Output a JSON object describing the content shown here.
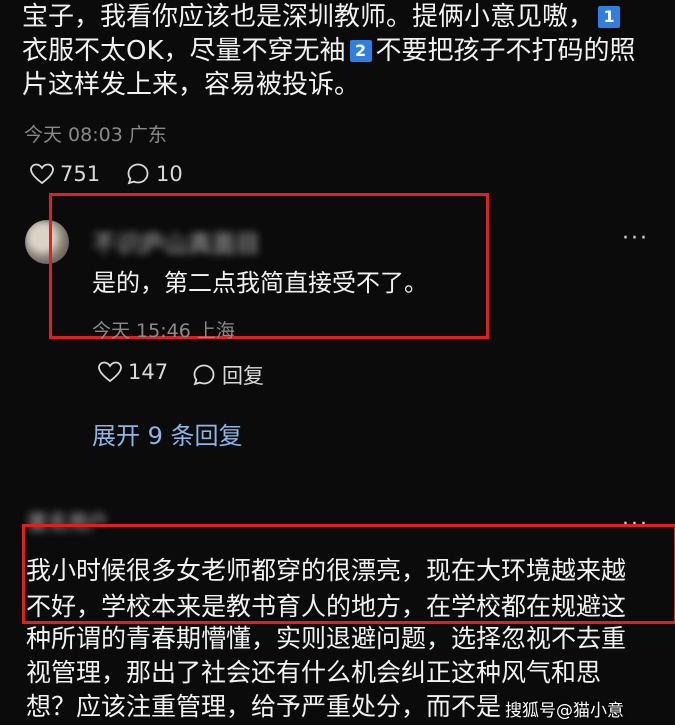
{
  "comment1": {
    "line1": "宝子，我看你应该也是深圳教师。提俩小意见嗷，",
    "badge1": "1",
    "line2a": "衣服不太OK，尽量不穿无袖",
    "badge2": "2",
    "line2b": "不要把孩子不打码的照",
    "line3": "片这样发上来，容易被投诉。",
    "timestamp": "今天 08:03 广东",
    "likes": "751",
    "replies": "10"
  },
  "reply1": {
    "username": "不识庐山真面目",
    "text": "是的，第二点我简直接受不了。",
    "timestamp": "今天 15:46 上海",
    "likes": "147",
    "reply_label": "回复",
    "more_label": "···"
  },
  "expand_label": "展开 9 条回复",
  "comment2": {
    "username": "匿名用户",
    "more_label": "···",
    "line1": "我小时候很多女老师都穿的很漂亮，现在大环境越来越",
    "line2": "不好，学校本来是教书育人的地方，在学校都在规避这",
    "line3": "种所谓的青春期懵懂，实则退避问题，选择忽视不去重",
    "line4": "视管理，那出了社会还有什么机会纠正这种风气和思",
    "line5": "想？应该注重管理，给予严重处分，而不是"
  },
  "watermark": "搜狐号@猫小意",
  "colors": {
    "background": "#0b0b0b",
    "badge": "#2f7fe0",
    "highlight_box": "#e02020",
    "link": "#8fb4e6"
  },
  "icons": [
    "heart-icon",
    "comment-icon",
    "more-icon"
  ]
}
